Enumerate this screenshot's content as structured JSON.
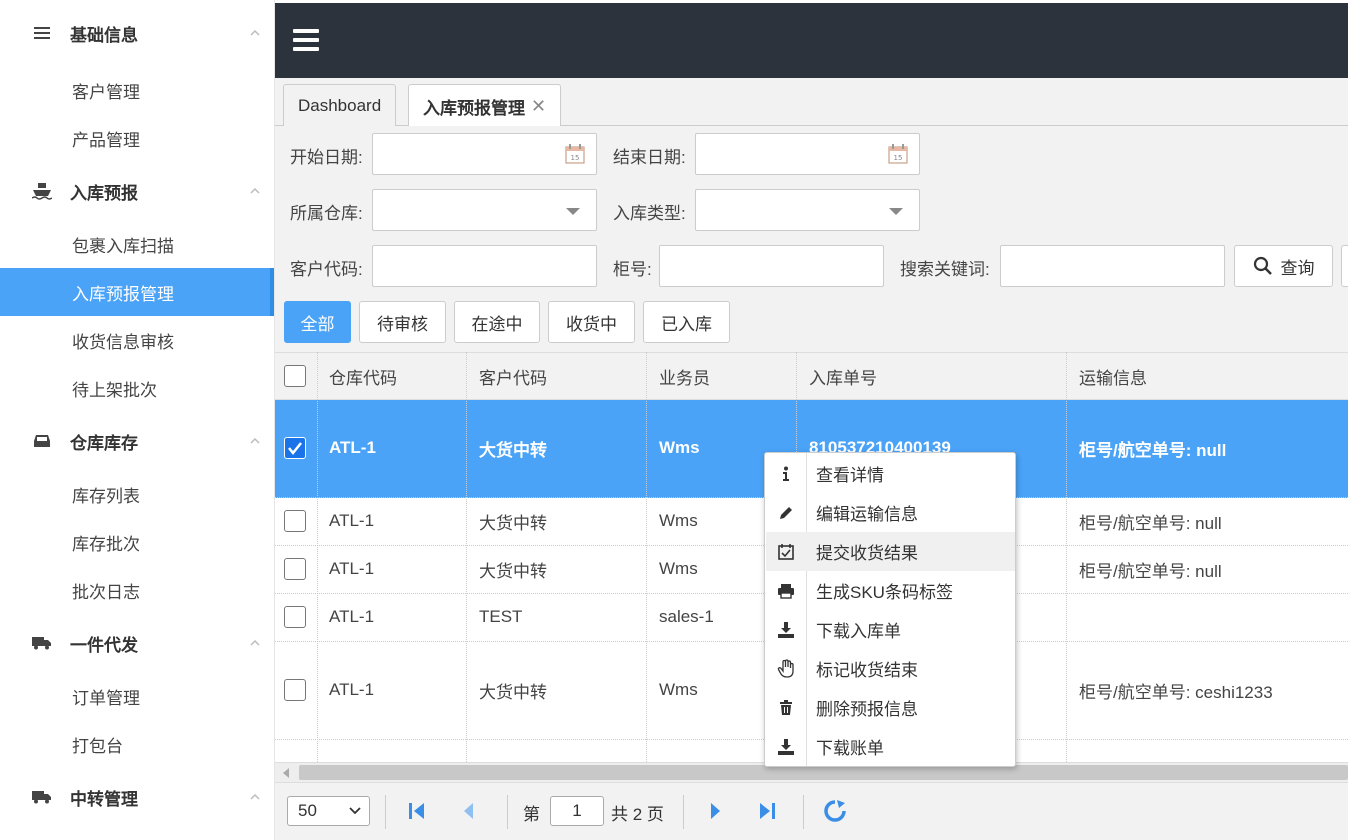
{
  "sidebar": {
    "groups": [
      {
        "title": "基础信息",
        "icon": "list-icon",
        "items": [
          "客户管理",
          "产品管理"
        ]
      },
      {
        "title": "入库预报",
        "icon": "ship-icon",
        "items": [
          "包裹入库扫描",
          "入库预报管理",
          "收货信息审核",
          "待上架批次"
        ]
      },
      {
        "title": "仓库库存",
        "icon": "inbox-icon",
        "items": [
          "库存列表",
          "库存批次",
          "批次日志"
        ]
      },
      {
        "title": "一件代发",
        "icon": "truck-icon",
        "items": [
          "订单管理",
          "打包台"
        ]
      },
      {
        "title": "中转管理",
        "icon": "truck-icon",
        "items": []
      }
    ],
    "active_item": "入库预报管理"
  },
  "tabs": [
    {
      "label": "Dashboard"
    },
    {
      "label": "入库预报管理",
      "active": true
    }
  ],
  "filters": {
    "start_date_label": "开始日期:",
    "end_date_label": "结束日期:",
    "warehouse_label": "所属仓库:",
    "inbound_type_label": "入库类型:",
    "customer_code_label": "客户代码:",
    "container_label": "柜号:",
    "keyword_label": "搜索关键词:",
    "search_button": "查询"
  },
  "status_tabs": [
    "全部",
    "待审核",
    "在途中",
    "收货中",
    "已入库"
  ],
  "table": {
    "columns": [
      "仓库代码",
      "客户代码",
      "业务员",
      "入库单号",
      "运输信息"
    ],
    "rows": [
      {
        "warehouse": "ATL-1",
        "customer": "大货中转",
        "sales": "Wms",
        "order_no": "810537210400139",
        "transport": "柜号/航空单号: null",
        "checked": true
      },
      {
        "warehouse": "ATL-1",
        "customer": "大货中转",
        "sales": "Wms",
        "order_no": "",
        "transport": "柜号/航空单号: null",
        "checked": false
      },
      {
        "warehouse": "ATL-1",
        "customer": "大货中转",
        "sales": "Wms",
        "order_no": "",
        "transport": "柜号/航空单号: null",
        "checked": false
      },
      {
        "warehouse": "ATL-1",
        "customer": "TEST",
        "sales": "sales-1",
        "order_no": "",
        "transport": "",
        "checked": false
      },
      {
        "warehouse": "ATL-1",
        "customer": "大货中转",
        "sales": "Wms",
        "order_no": "",
        "transport": "柜号/航空单号: ceshi1233",
        "checked": false
      }
    ]
  },
  "context_menu": {
    "items": [
      {
        "label": "查看详情",
        "icon": "info-icon"
      },
      {
        "label": "编辑运输信息",
        "icon": "pencil-icon"
      },
      {
        "label": "提交收货结果",
        "icon": "calendar-check-icon"
      },
      {
        "label": "生成SKU条码标签",
        "icon": "printer-icon"
      },
      {
        "label": "下载入库单",
        "icon": "download-icon"
      },
      {
        "label": "标记收货结束",
        "icon": "hand-icon"
      },
      {
        "label": "删除预报信息",
        "icon": "trash-icon"
      },
      {
        "label": "下载账单",
        "icon": "download-icon"
      }
    ]
  },
  "pager": {
    "page_size": "50",
    "page_prefix": "第",
    "current_page": "1",
    "total_text": "共 2 页"
  },
  "colors": {
    "accent": "#4aa3f7",
    "topbar": "#2d333c",
    "pager_icon": "#3a8ee6"
  }
}
